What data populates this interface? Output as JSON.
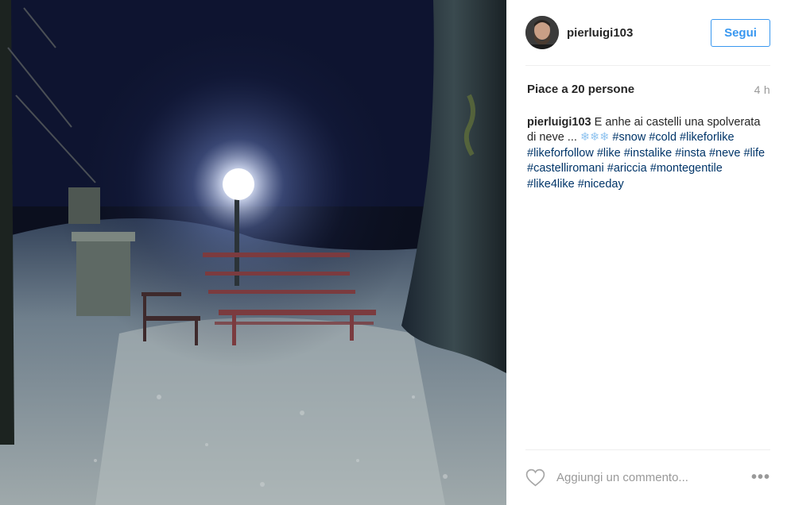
{
  "post": {
    "username": "pierluigi103",
    "follow_label": "Segui",
    "likes_text": "Piace a 20 persone",
    "time_ago": "4 h",
    "caption": {
      "username": "pierluigi103",
      "text_before": "E anhe ai castelli una spolverata di neve ... ",
      "emoji": "❄❄❄",
      "hashtags": [
        "#snow",
        "#cold",
        "#likeforlike",
        "#likeforfollow",
        "#like",
        "#instalike",
        "#insta",
        "#neve",
        "#life",
        "#castelliromani",
        "#ariccia",
        "#montegentile",
        "#like4like",
        "#niceday"
      ]
    },
    "comment_placeholder": "Aggiungi un commento...",
    "more_label": "•••"
  },
  "colors": {
    "accent": "#3897f0",
    "hashtag": "#003569",
    "muted": "#999999"
  },
  "icons": {
    "like": "heart-outline-icon",
    "more": "more-options-icon",
    "avatar": "user-avatar"
  }
}
